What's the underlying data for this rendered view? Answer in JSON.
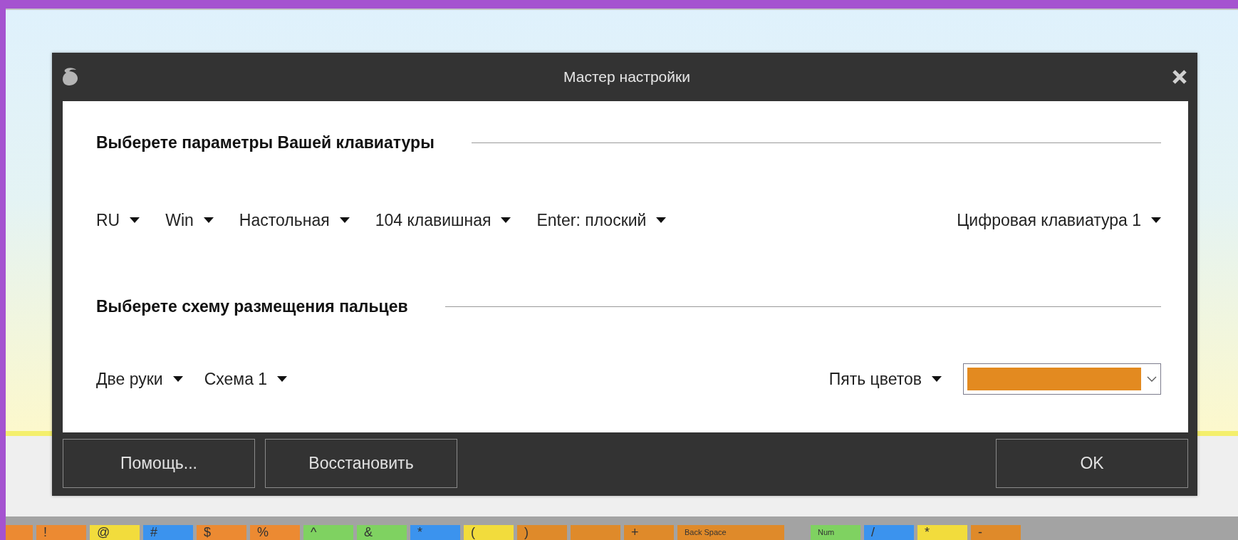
{
  "window": {
    "title": "Мастер настройки"
  },
  "sections": [
    {
      "heading": "Выберете параметры Вашей клавиатуры",
      "dropdowns": [
        {
          "label": "RU"
        },
        {
          "label": "Win"
        },
        {
          "label": "Настольная"
        },
        {
          "label": "104 клавишная"
        },
        {
          "label": "Enter: плоский"
        },
        {
          "label": "Цифровая клавиатура 1"
        }
      ]
    },
    {
      "heading": "Выберете схему размещения пальцев",
      "dropdowns": [
        {
          "label": "Две руки"
        },
        {
          "label": "Схема 1"
        }
      ],
      "color_mode": {
        "label": "Пять цветов"
      },
      "color_select": {
        "color": "#e38a20"
      }
    }
  ],
  "footer": {
    "left_buttons": [
      "Помощь...",
      "Восстановить"
    ],
    "right_buttons": [
      "OK"
    ]
  },
  "keyboard": {
    "main": [
      {
        "kind": "edge",
        "color": "#ec8a32"
      },
      {
        "kind": "normal",
        "label": "!",
        "color": "#ec8a32"
      },
      {
        "kind": "normal",
        "label": "@",
        "color": "#f2dc3c"
      },
      {
        "kind": "normal",
        "label": "#",
        "color": "#3b93ee"
      },
      {
        "kind": "normal",
        "label": "$",
        "color": "#ec8a32"
      },
      {
        "kind": "normal",
        "label": "%",
        "color": "#ec8a32"
      },
      {
        "kind": "normal",
        "label": "^",
        "color": "#7fd261"
      },
      {
        "kind": "normal",
        "label": "&",
        "color": "#7fd261"
      },
      {
        "kind": "normal",
        "label": "*",
        "color": "#3b93ee"
      },
      {
        "kind": "normal",
        "label": "(",
        "color": "#f2dc3c"
      },
      {
        "kind": "normal",
        "label": ")",
        "color": "#df8a2a"
      },
      {
        "kind": "normal",
        "color": "#df8a2a"
      },
      {
        "kind": "normal",
        "label": "+",
        "color": "#df8a2a"
      },
      {
        "kind": "wide",
        "label": "Back Space",
        "color": "#df8a2a"
      }
    ],
    "numpad": [
      {
        "kind": "word",
        "label": "Num",
        "color": "#7fd261"
      },
      {
        "kind": "normal",
        "label": "/",
        "color": "#3b93ee"
      },
      {
        "kind": "normal",
        "label": "*",
        "color": "#f2dc3c"
      },
      {
        "kind": "normal",
        "label": "-",
        "color": "#df8a2a"
      }
    ]
  }
}
